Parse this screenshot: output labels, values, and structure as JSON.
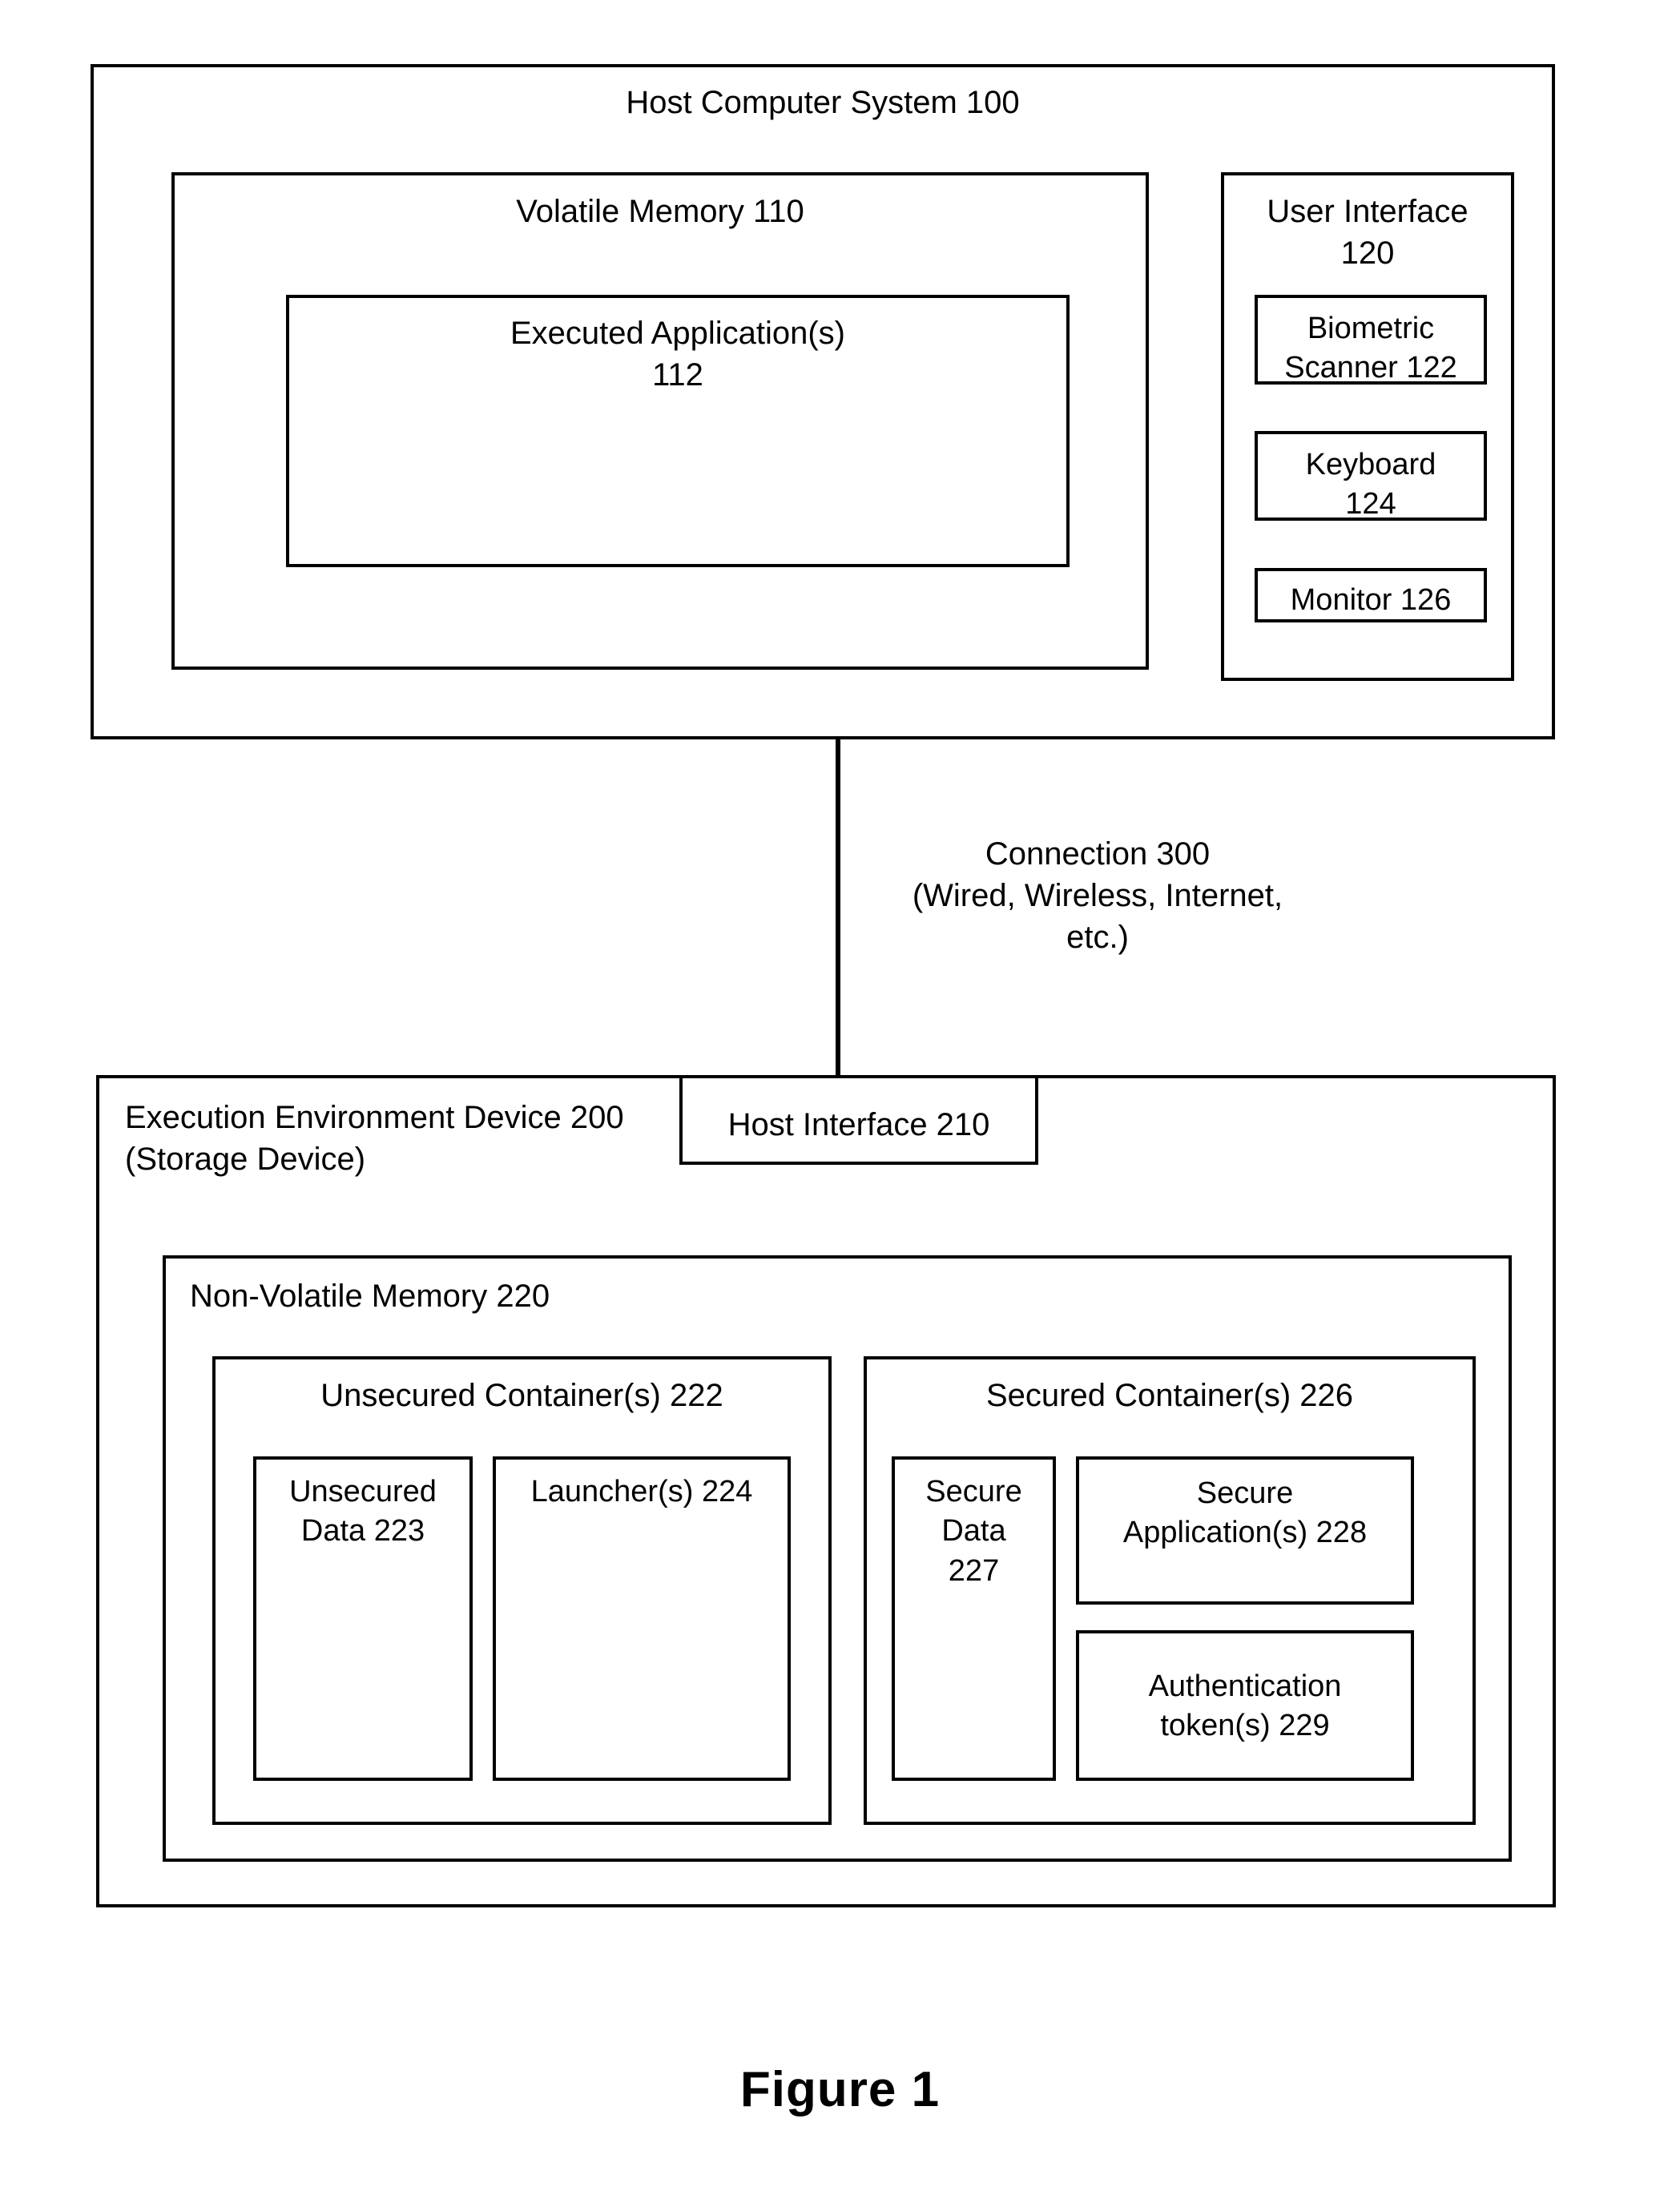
{
  "figure": {
    "caption": "Figure 1"
  },
  "host_system": {
    "title": "Host Computer System 100",
    "volatile_memory": {
      "title": "Volatile Memory 110",
      "executed_applications": {
        "title": "Executed Application(s)\n112"
      }
    },
    "user_interface": {
      "title": "User Interface\n120",
      "biometric_scanner": "Biometric\nScanner 122",
      "keyboard": "Keyboard\n124",
      "monitor": "Monitor 126"
    }
  },
  "connection": {
    "label": "Connection 300\n(Wired, Wireless, Internet,\netc.)"
  },
  "execution_environment": {
    "title": "Execution Environment Device 200\n(Storage Device)",
    "host_interface": {
      "title": "Host Interface 210"
    },
    "non_volatile_memory": {
      "title": "Non-Volatile Memory 220",
      "unsecured_container": {
        "title": "Unsecured Container(s) 222",
        "unsecured_data": "Unsecured\nData 223",
        "launchers": "Launcher(s) 224"
      },
      "secured_container": {
        "title": "Secured Container(s) 226",
        "secure_data": "Secure\nData\n227",
        "secure_applications": "Secure\nApplication(s) 228",
        "authentication_tokens": "Authentication\ntoken(s) 229"
      }
    }
  }
}
